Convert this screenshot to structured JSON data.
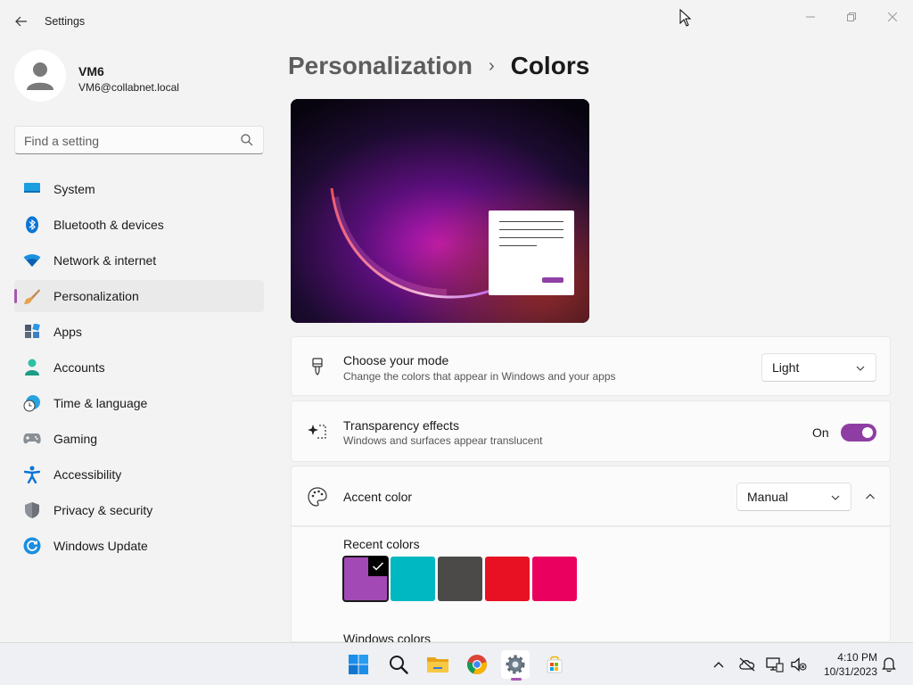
{
  "window": {
    "app_title": "Settings"
  },
  "profile": {
    "name": "VM6",
    "email": "VM6@collabnet.local"
  },
  "search": {
    "placeholder": "Find a setting"
  },
  "nav": {
    "items": [
      {
        "label": "System",
        "icon": "monitor-icon"
      },
      {
        "label": "Bluetooth & devices",
        "icon": "bluetooth-icon"
      },
      {
        "label": "Network & internet",
        "icon": "wifi-icon"
      },
      {
        "label": "Personalization",
        "icon": "brush-icon",
        "active": true
      },
      {
        "label": "Apps",
        "icon": "apps-icon"
      },
      {
        "label": "Accounts",
        "icon": "person-icon"
      },
      {
        "label": "Time & language",
        "icon": "globe-clock-icon"
      },
      {
        "label": "Gaming",
        "icon": "gamepad-icon"
      },
      {
        "label": "Accessibility",
        "icon": "accessibility-icon"
      },
      {
        "label": "Privacy & security",
        "icon": "shield-icon"
      },
      {
        "label": "Windows Update",
        "icon": "update-icon"
      }
    ]
  },
  "breadcrumb": {
    "parent": "Personalization",
    "separator": "›",
    "current": "Colors"
  },
  "mode": {
    "title": "Choose your mode",
    "description": "Change the colors that appear in Windows and your apps",
    "value": "Light"
  },
  "transparency": {
    "title": "Transparency effects",
    "description": "Windows and surfaces appear translucent",
    "state_label": "On",
    "enabled": true
  },
  "accent": {
    "title": "Accent color",
    "value": "Manual",
    "recent_label": "Recent colors",
    "recent_colors": [
      "#a349b6",
      "#00b8c2",
      "#4c4a48",
      "#e81123",
      "#ea005e"
    ],
    "selected_index": 0,
    "windows_colors_label": "Windows colors"
  },
  "colors": {
    "accent": "#8e3ea3",
    "background": "#f3f3f3",
    "card": "#fbfbfb"
  },
  "taskbar": {
    "apps": [
      "start-icon",
      "search-icon",
      "file-explorer-icon",
      "chrome-icon",
      "settings-icon",
      "store-icon"
    ],
    "time": "4:10 PM",
    "date": "10/31/2023"
  }
}
